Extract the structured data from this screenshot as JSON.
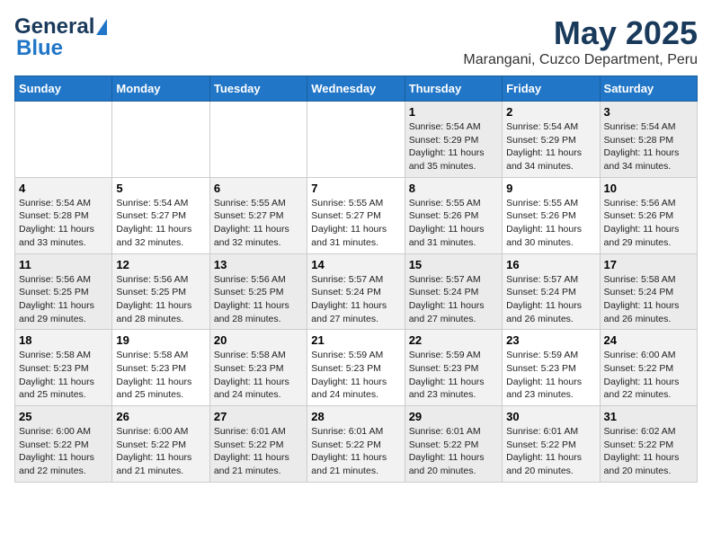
{
  "header": {
    "logo_line1": "General",
    "logo_line2": "Blue",
    "title": "May 2025",
    "subtitle": "Marangani, Cuzco Department, Peru"
  },
  "days_of_week": [
    "Sunday",
    "Monday",
    "Tuesday",
    "Wednesday",
    "Thursday",
    "Friday",
    "Saturday"
  ],
  "weeks": [
    [
      {
        "day": "",
        "info": ""
      },
      {
        "day": "",
        "info": ""
      },
      {
        "day": "",
        "info": ""
      },
      {
        "day": "",
        "info": ""
      },
      {
        "day": "1",
        "info": "Sunrise: 5:54 AM\nSunset: 5:29 PM\nDaylight: 11 hours\nand 35 minutes."
      },
      {
        "day": "2",
        "info": "Sunrise: 5:54 AM\nSunset: 5:29 PM\nDaylight: 11 hours\nand 34 minutes."
      },
      {
        "day": "3",
        "info": "Sunrise: 5:54 AM\nSunset: 5:28 PM\nDaylight: 11 hours\nand 34 minutes."
      }
    ],
    [
      {
        "day": "4",
        "info": "Sunrise: 5:54 AM\nSunset: 5:28 PM\nDaylight: 11 hours\nand 33 minutes."
      },
      {
        "day": "5",
        "info": "Sunrise: 5:54 AM\nSunset: 5:27 PM\nDaylight: 11 hours\nand 32 minutes."
      },
      {
        "day": "6",
        "info": "Sunrise: 5:55 AM\nSunset: 5:27 PM\nDaylight: 11 hours\nand 32 minutes."
      },
      {
        "day": "7",
        "info": "Sunrise: 5:55 AM\nSunset: 5:27 PM\nDaylight: 11 hours\nand 31 minutes."
      },
      {
        "day": "8",
        "info": "Sunrise: 5:55 AM\nSunset: 5:26 PM\nDaylight: 11 hours\nand 31 minutes."
      },
      {
        "day": "9",
        "info": "Sunrise: 5:55 AM\nSunset: 5:26 PM\nDaylight: 11 hours\nand 30 minutes."
      },
      {
        "day": "10",
        "info": "Sunrise: 5:56 AM\nSunset: 5:26 PM\nDaylight: 11 hours\nand 29 minutes."
      }
    ],
    [
      {
        "day": "11",
        "info": "Sunrise: 5:56 AM\nSunset: 5:25 PM\nDaylight: 11 hours\nand 29 minutes."
      },
      {
        "day": "12",
        "info": "Sunrise: 5:56 AM\nSunset: 5:25 PM\nDaylight: 11 hours\nand 28 minutes."
      },
      {
        "day": "13",
        "info": "Sunrise: 5:56 AM\nSunset: 5:25 PM\nDaylight: 11 hours\nand 28 minutes."
      },
      {
        "day": "14",
        "info": "Sunrise: 5:57 AM\nSunset: 5:24 PM\nDaylight: 11 hours\nand 27 minutes."
      },
      {
        "day": "15",
        "info": "Sunrise: 5:57 AM\nSunset: 5:24 PM\nDaylight: 11 hours\nand 27 minutes."
      },
      {
        "day": "16",
        "info": "Sunrise: 5:57 AM\nSunset: 5:24 PM\nDaylight: 11 hours\nand 26 minutes."
      },
      {
        "day": "17",
        "info": "Sunrise: 5:58 AM\nSunset: 5:24 PM\nDaylight: 11 hours\nand 26 minutes."
      }
    ],
    [
      {
        "day": "18",
        "info": "Sunrise: 5:58 AM\nSunset: 5:23 PM\nDaylight: 11 hours\nand 25 minutes."
      },
      {
        "day": "19",
        "info": "Sunrise: 5:58 AM\nSunset: 5:23 PM\nDaylight: 11 hours\nand 25 minutes."
      },
      {
        "day": "20",
        "info": "Sunrise: 5:58 AM\nSunset: 5:23 PM\nDaylight: 11 hours\nand 24 minutes."
      },
      {
        "day": "21",
        "info": "Sunrise: 5:59 AM\nSunset: 5:23 PM\nDaylight: 11 hours\nand 24 minutes."
      },
      {
        "day": "22",
        "info": "Sunrise: 5:59 AM\nSunset: 5:23 PM\nDaylight: 11 hours\nand 23 minutes."
      },
      {
        "day": "23",
        "info": "Sunrise: 5:59 AM\nSunset: 5:23 PM\nDaylight: 11 hours\nand 23 minutes."
      },
      {
        "day": "24",
        "info": "Sunrise: 6:00 AM\nSunset: 5:22 PM\nDaylight: 11 hours\nand 22 minutes."
      }
    ],
    [
      {
        "day": "25",
        "info": "Sunrise: 6:00 AM\nSunset: 5:22 PM\nDaylight: 11 hours\nand 22 minutes."
      },
      {
        "day": "26",
        "info": "Sunrise: 6:00 AM\nSunset: 5:22 PM\nDaylight: 11 hours\nand 21 minutes."
      },
      {
        "day": "27",
        "info": "Sunrise: 6:01 AM\nSunset: 5:22 PM\nDaylight: 11 hours\nand 21 minutes."
      },
      {
        "day": "28",
        "info": "Sunrise: 6:01 AM\nSunset: 5:22 PM\nDaylight: 11 hours\nand 21 minutes."
      },
      {
        "day": "29",
        "info": "Sunrise: 6:01 AM\nSunset: 5:22 PM\nDaylight: 11 hours\nand 20 minutes."
      },
      {
        "day": "30",
        "info": "Sunrise: 6:01 AM\nSunset: 5:22 PM\nDaylight: 11 hours\nand 20 minutes."
      },
      {
        "day": "31",
        "info": "Sunrise: 6:02 AM\nSunset: 5:22 PM\nDaylight: 11 hours\nand 20 minutes."
      }
    ]
  ]
}
